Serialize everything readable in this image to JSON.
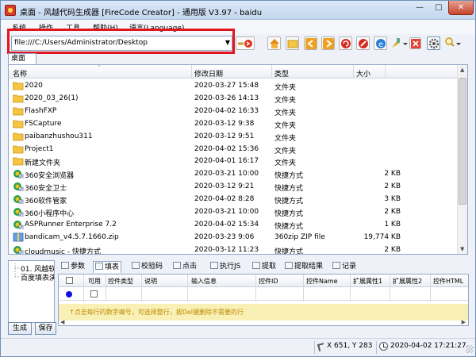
{
  "window": {
    "title": "桌面 - 风越代码生成器 [FireCode Creator] - 通用版 V3.97 - baidu"
  },
  "menu": [
    "系统",
    "操作",
    "工具",
    "帮助(H)",
    "语言(Language)"
  ],
  "address": {
    "value": "file:///C:/Users/Administrator/Desktop"
  },
  "tab_label": "桌面",
  "file_list": {
    "columns": [
      "名称",
      "修改日期",
      "类型",
      "大小"
    ],
    "rows": [
      {
        "name": "2020",
        "date": "2020-03-27 15:48",
        "type": "文件夹",
        "size": "",
        "icon": "folder-icon"
      },
      {
        "name": "2020_03_26(1)",
        "date": "2020-03-26 14:13",
        "type": "文件夹",
        "size": "",
        "icon": "folder-icon"
      },
      {
        "name": "FlashFXP",
        "date": "2020-04-02 16:33",
        "type": "文件夹",
        "size": "",
        "icon": "folder-icon"
      },
      {
        "name": "FSCapture",
        "date": "2020-03-12 9:38",
        "type": "文件夹",
        "size": "",
        "icon": "folder-icon"
      },
      {
        "name": "paibanzhushou311",
        "date": "2020-03-12 9:51",
        "type": "文件夹",
        "size": "",
        "icon": "folder-icon"
      },
      {
        "name": "Project1",
        "date": "2020-04-02 15:36",
        "type": "文件夹",
        "size": "",
        "icon": "folder-icon"
      },
      {
        "name": "新建文件夹",
        "date": "2020-04-01 16:17",
        "type": "文件夹",
        "size": "",
        "icon": "folder-icon"
      },
      {
        "name": "360安全浏览器",
        "date": "2020-03-21 10:00",
        "type": "快捷方式",
        "size": "2 KB",
        "icon": "shortcut-icon"
      },
      {
        "name": "360安全卫士",
        "date": "2020-03-12 9:21",
        "type": "快捷方式",
        "size": "2 KB",
        "icon": "shortcut-icon"
      },
      {
        "name": "360软件管家",
        "date": "2020-04-02 8:28",
        "type": "快捷方式",
        "size": "3 KB",
        "icon": "shortcut-icon"
      },
      {
        "name": "360小程序中心",
        "date": "2020-03-21 10:00",
        "type": "快捷方式",
        "size": "2 KB",
        "icon": "shortcut-icon"
      },
      {
        "name": "ASPRunner Enterprise 7.2",
        "date": "2020-04-02 15:34",
        "type": "快捷方式",
        "size": "1 KB",
        "icon": "shortcut-icon"
      },
      {
        "name": "bandicam_v4.5.7.1660.zip",
        "date": "2020-03-23 9:06",
        "type": "360zip ZIP file",
        "size": "19,774 KB",
        "icon": "zip-icon"
      },
      {
        "name": "cloudmusic - 快捷方式",
        "date": "2020-03-12 11:23",
        "type": "快捷方式",
        "size": "2 KB",
        "icon": "shortcut-icon"
      }
    ]
  },
  "tree": [
    "01. 风越软",
    "百度填表演"
  ],
  "buttons": {
    "generate": "生成",
    "save": "保存"
  },
  "bottom_tabs": [
    "参数",
    "填表",
    "校验码",
    "点击",
    "执行JS",
    "提取",
    "提取结果",
    "记录"
  ],
  "grid": {
    "columns": [
      "",
      "可用",
      "控件类型",
      "说明",
      "输入信息",
      "控件ID",
      "控件Name",
      "扩展属性1",
      "扩展属性2",
      "控件HTML"
    ],
    "hint": "↑点击每行的数字编号，可选择整行，按Del键删除不需要的行"
  },
  "status": {
    "cursor": "X 651, Y 283",
    "datetime": "2020-04-02 17:21:27"
  },
  "colors": {
    "highlight": "#e0161f",
    "hint_background": "#f8f0b4",
    "hint_text": "#c08a00"
  }
}
